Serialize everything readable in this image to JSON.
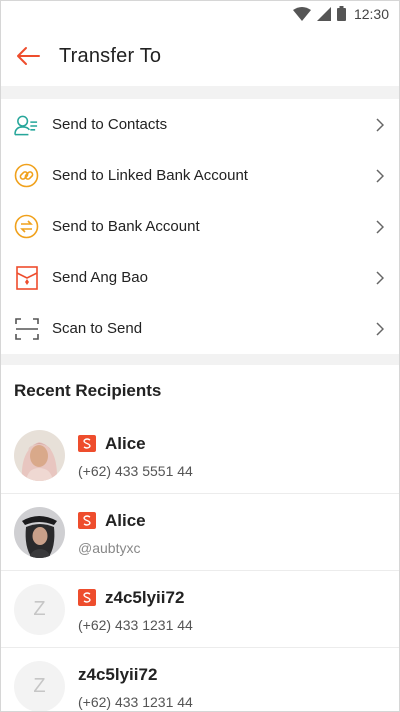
{
  "status_bar": {
    "time": "12:30"
  },
  "header": {
    "title": "Transfer To"
  },
  "menu": [
    {
      "label": "Send to Contacts",
      "icon": "contacts-icon",
      "color": "#26a69a"
    },
    {
      "label": "Send to Linked Bank Account",
      "icon": "linked-bank-icon",
      "color": "#f0a11c"
    },
    {
      "label": "Send to Bank Account",
      "icon": "bank-transfer-icon",
      "color": "#f0a11c"
    },
    {
      "label": "Send Ang Bao",
      "icon": "ang-bao-icon",
      "color": "#ee4d2d"
    },
    {
      "label": "Scan to Send",
      "icon": "scan-icon",
      "color": "#555555"
    }
  ],
  "recent": {
    "title": "Recent Recipients",
    "items": [
      {
        "name": "Alice",
        "detail": "(+62) 433 5551 44",
        "badge": true,
        "avatar": "photo"
      },
      {
        "name": "Alice",
        "detail": "@aubtyxc",
        "badge": true,
        "avatar": "photo"
      },
      {
        "name": "z4c5lyii72",
        "detail": "(+62) 433 1231 44",
        "badge": true,
        "avatar": "Z"
      },
      {
        "name": "z4c5lyii72",
        "detail": "(+62) 433 1231 44",
        "badge": false,
        "avatar": "Z"
      }
    ]
  },
  "colors": {
    "accent": "#ee4d2d",
    "divider": "#f2f2f2"
  }
}
